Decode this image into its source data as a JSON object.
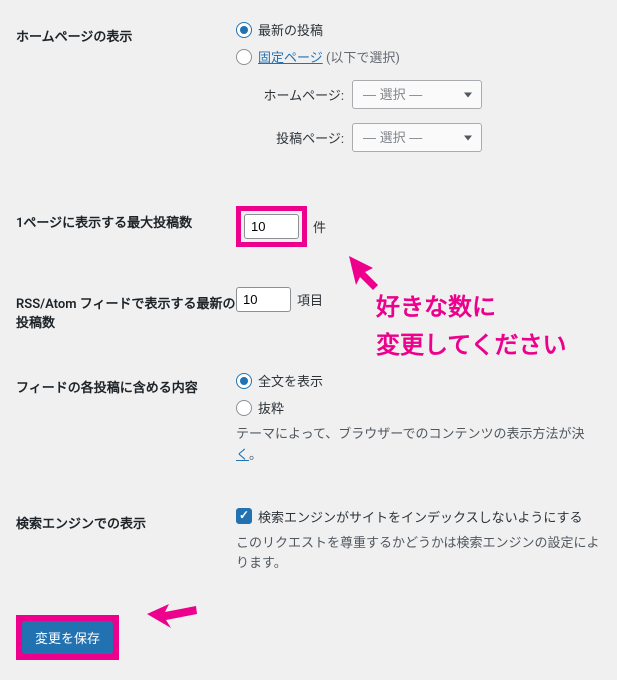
{
  "homepage_display": {
    "label": "ホームページの表示",
    "latest_posts_label": "最新の投稿",
    "static_page_link": "固定ページ",
    "static_page_suffix": "(以下で選択)",
    "homepage_sub_label": "ホームページ:",
    "posts_page_sub_label": "投稿ページ:",
    "select_placeholder": "— 選択 —"
  },
  "posts_per_page": {
    "label": "1ページに表示する最大投稿数",
    "value": "10",
    "unit": "件"
  },
  "rss_count": {
    "label": "RSS/Atom フィードで表示する最新の投稿数",
    "value": "10",
    "unit": "項目"
  },
  "feed_content": {
    "label": "フィードの各投稿に含める内容",
    "full_text_label": "全文を表示",
    "summary_label": "抜粋",
    "description": "テーマによって、ブラウザーでのコンテンツの表示方法が決まります。",
    "description_prefix": "テーマによって、ブラウザーでのコンテンツの表示方法が決",
    "link_text": "く",
    "suffix": "。"
  },
  "search_engine": {
    "label": "検索エンジンでの表示",
    "checkbox_label": "検索エンジンがサイトをインデックスしないようにする",
    "description": "このリクエストを尊重するかどうかは検索エンジンの設定によります。"
  },
  "submit": {
    "button_label": "変更を保存"
  },
  "annotation": {
    "line1": "好きな数に",
    "line2": "変更してください"
  }
}
